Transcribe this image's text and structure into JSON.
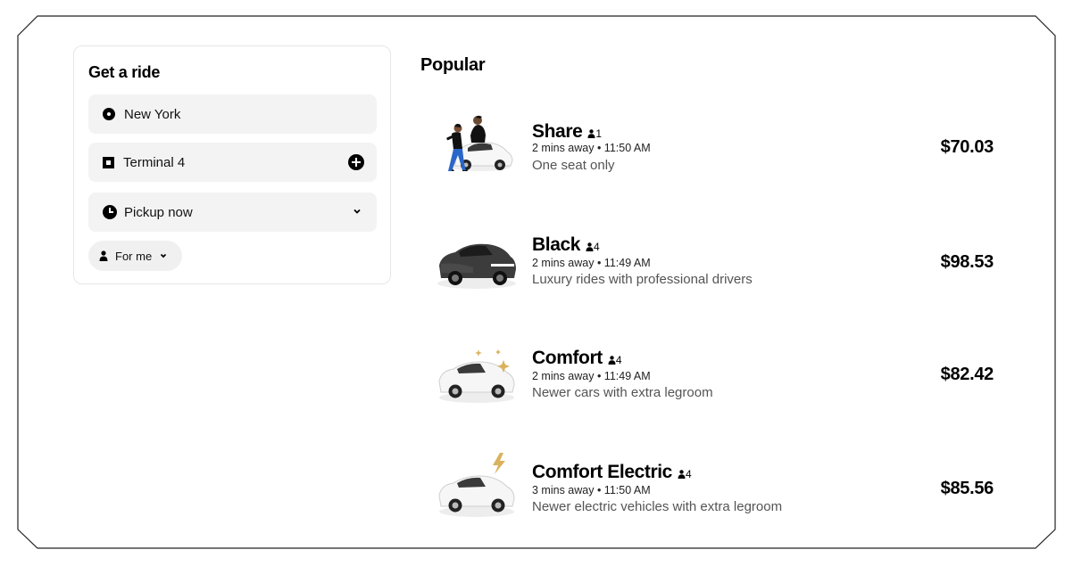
{
  "ride_form": {
    "title": "Get a ride",
    "pickup": "New York",
    "dropoff": "Terminal 4",
    "pickup_time": "Pickup now",
    "rider": "For me"
  },
  "list": {
    "title": "Popular",
    "options": [
      {
        "name": "Share",
        "capacity": "1",
        "eta": "2 mins away • 11:50 AM",
        "description": "One seat only",
        "price": "$70.03",
        "image": "share-riders-car-illustration"
      },
      {
        "name": "Black",
        "capacity": "4",
        "eta": "2 mins away • 11:49 AM",
        "description": "Luxury rides with professional drivers",
        "price": "$98.53",
        "image": "black-sedan-illustration"
      },
      {
        "name": "Comfort",
        "capacity": "4",
        "eta": "2 mins away • 11:49 AM",
        "description": "Newer cars with extra legroom",
        "price": "$82.42",
        "image": "sparkle-white-car-illustration"
      },
      {
        "name": "Comfort Electric",
        "capacity": "4",
        "eta": "3 mins away • 11:50 AM",
        "description": "Newer electric vehicles with extra legroom",
        "price": "$85.56",
        "image": "electric-car-bolt-illustration"
      }
    ]
  },
  "colors": {
    "field_bg": "#f3f3f3",
    "muted_text": "#545454",
    "accent_gold": "#d9b25e"
  }
}
